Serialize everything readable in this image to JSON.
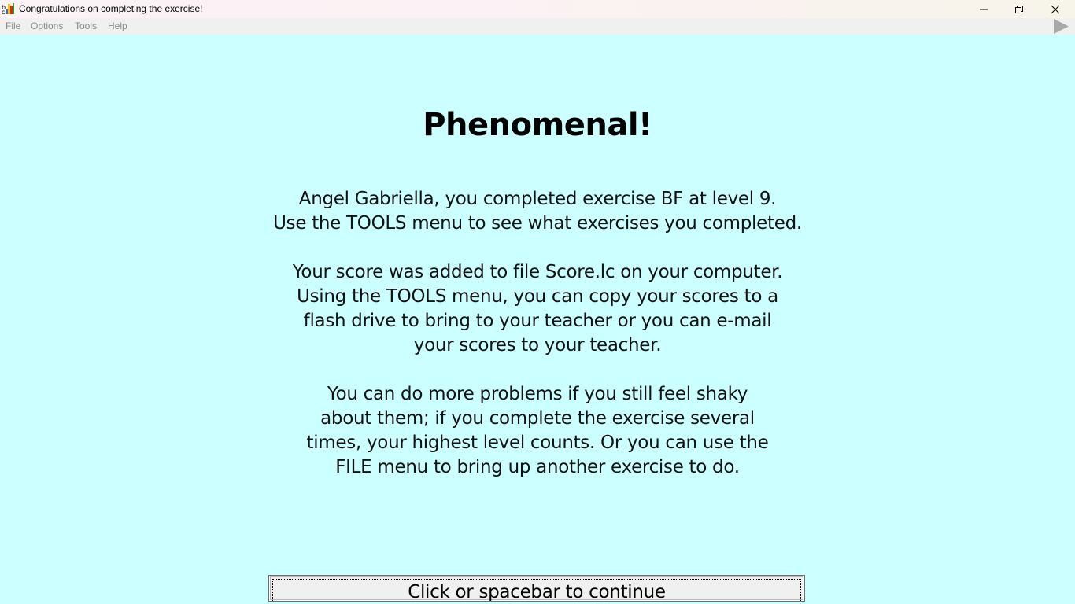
{
  "window": {
    "title": "Congratulations on completing the exercise!",
    "icon": "app-icon",
    "controls": {
      "minimize_icon": "minimize-icon",
      "maximize_icon": "restore-icon",
      "close_icon": "close-icon"
    }
  },
  "menubar": {
    "items": [
      "File",
      "Options",
      "Tools",
      "Help"
    ],
    "play_icon": "play-icon"
  },
  "content": {
    "headline": "Phenomenal!",
    "paragraph1": [
      "Angel Gabriella, you completed exercise BF at level 9.",
      "Use the TOOLS menu to see what exercises you completed."
    ],
    "paragraph2": [
      "Your score was added to file Score.lc on your computer.",
      "Using the TOOLS menu, you can copy your scores to a",
      "flash drive to bring to your teacher or you can e-mail",
      "your scores to your teacher."
    ],
    "paragraph3": [
      "You can do more problems if you still feel shaky",
      "about them; if you complete the exercise several",
      "times, your highest level counts. Or you can use the",
      "FILE menu to bring up another exercise to do."
    ]
  },
  "continue_button": {
    "label": "Click or spacebar to continue"
  },
  "colors": {
    "background": "#ccffff",
    "menubar": "#f0f0f0",
    "menu_text_disabled": "#8a8a8a"
  }
}
